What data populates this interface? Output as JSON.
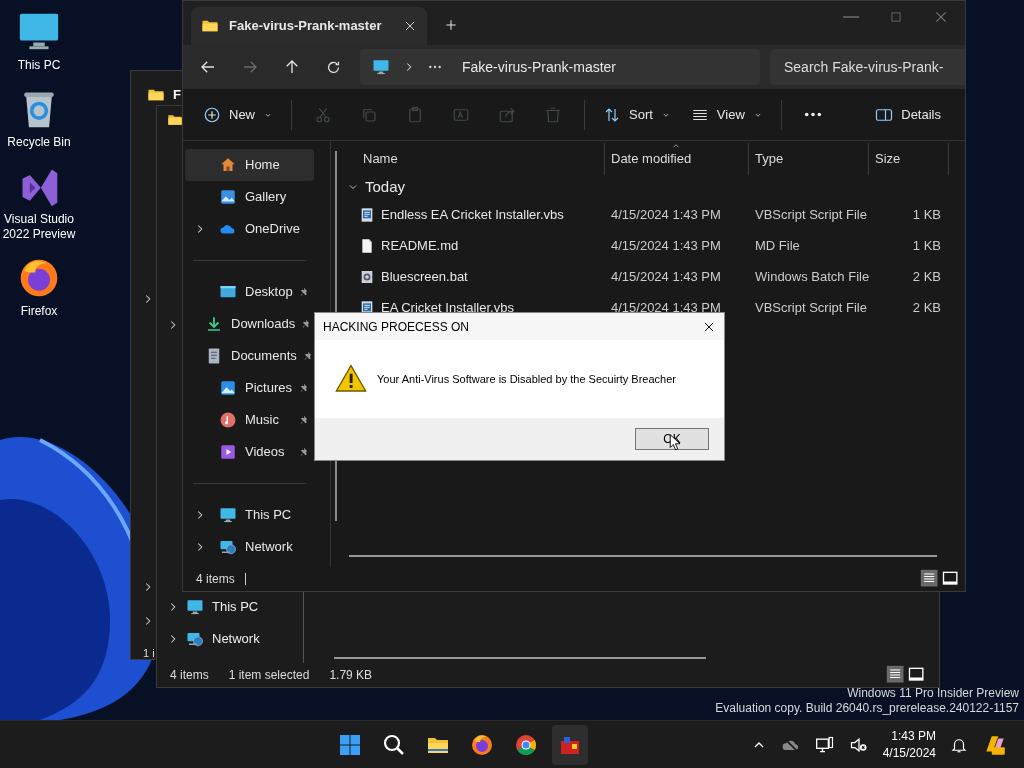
{
  "desktop_icons": [
    {
      "kind": "pc",
      "label": "This PC"
    },
    {
      "kind": "bin",
      "label": "Recycle Bin"
    },
    {
      "kind": "vs",
      "label": "Visual Studio 2022 Preview"
    },
    {
      "kind": "firefox",
      "label": "Firefox"
    }
  ],
  "back_window_1": {
    "title": "F",
    "status": "1 i"
  },
  "back_window_2": {
    "nav_items": [
      {
        "kind": "pc",
        "label": "This PC"
      },
      {
        "kind": "network",
        "label": "Network"
      }
    ],
    "status": [
      "4 items",
      "1 item selected",
      "1.79 KB"
    ]
  },
  "explorer": {
    "tab_title": "Fake-virus-Prank-master",
    "address": "Fake-virus-Prank-master",
    "search": {
      "placeholder": "Search Fake-virus-Prank-"
    },
    "toolbar": [
      {
        "kind": "new",
        "label": "New",
        "disabled": false
      },
      {
        "kind": "cut",
        "disabled": true
      },
      {
        "kind": "copy",
        "disabled": true
      },
      {
        "kind": "paste",
        "disabled": true
      },
      {
        "kind": "rename",
        "disabled": true
      },
      {
        "kind": "share",
        "disabled": true
      },
      {
        "kind": "delete",
        "disabled": true
      },
      {
        "kind": "sort",
        "label": "Sort",
        "disabled": false
      },
      {
        "kind": "view",
        "label": "View",
        "disabled": false
      },
      {
        "kind": "more",
        "disabled": false
      },
      {
        "kind": "details",
        "label": "Details",
        "disabled": false
      }
    ],
    "sidebar": {
      "sections": [
        [
          {
            "kind": "home",
            "label": "Home",
            "selected": true,
            "pinned": false,
            "expandable": false
          },
          {
            "kind": "gallery",
            "label": "Gallery",
            "selected": false,
            "pinned": false,
            "expandable": false
          },
          {
            "kind": "cloud",
            "label": "OneDrive",
            "selected": false,
            "pinned": false,
            "expandable": true
          }
        ],
        [
          {
            "kind": "desktop",
            "label": "Desktop",
            "selected": false,
            "pinned": true,
            "expandable": false
          },
          {
            "kind": "download",
            "label": "Downloads",
            "selected": false,
            "pinned": true,
            "expandable": false
          },
          {
            "kind": "document",
            "label": "Documents",
            "selected": false,
            "pinned": true,
            "expandable": false
          },
          {
            "kind": "picture",
            "label": "Pictures",
            "selected": false,
            "pinned": true,
            "expandable": false
          },
          {
            "kind": "music",
            "label": "Music",
            "selected": false,
            "pinned": true,
            "expandable": false
          },
          {
            "kind": "video",
            "label": "Videos",
            "selected": false,
            "pinned": true,
            "expandable": false
          }
        ],
        [
          {
            "kind": "pc",
            "label": "This PC",
            "selected": false,
            "pinned": false,
            "expandable": true
          },
          {
            "kind": "network",
            "label": "Network",
            "selected": false,
            "pinned": false,
            "expandable": true
          }
        ]
      ]
    },
    "table": {
      "columns": [
        "Name",
        "Date modified",
        "Type",
        "Size"
      ],
      "group": "Today",
      "rows": [
        {
          "kind": "script",
          "name": "Endless EA Cricket Installer.vbs",
          "date": "4/15/2024 1:43 PM",
          "type": "VBScript Script File",
          "size": "1 KB"
        },
        {
          "kind": "text",
          "name": "README.md",
          "date": "4/15/2024 1:43 PM",
          "type": "MD File",
          "size": "1 KB"
        },
        {
          "kind": "batch",
          "name": "Bluescreen.bat",
          "date": "4/15/2024 1:43 PM",
          "type": "Windows Batch File",
          "size": "2 KB"
        },
        {
          "kind": "script",
          "name": "EA Cricket Installer.vbs",
          "date": "4/15/2024 1:43 PM",
          "type": "VBScript Script File",
          "size": "2 KB"
        }
      ]
    },
    "status": "4 items"
  },
  "dialog": {
    "title": "HACKING PROECESS ON",
    "message": "Your Anti-Virus Software is Disabled by the Secuirty Breacher",
    "button": "OK"
  },
  "watermark": [
    "Windows 11 Pro Insider Preview",
    "Evaluation copy. Build 26040.rs_prerelease.240122-1157"
  ],
  "taskbar": {
    "apps": [
      {
        "kind": "start"
      },
      {
        "kind": "search"
      },
      {
        "kind": "explorer"
      },
      {
        "kind": "firefox"
      },
      {
        "kind": "chrome"
      },
      {
        "kind": "app"
      }
    ],
    "time": "1:43 PM",
    "date": "4/15/2024"
  }
}
